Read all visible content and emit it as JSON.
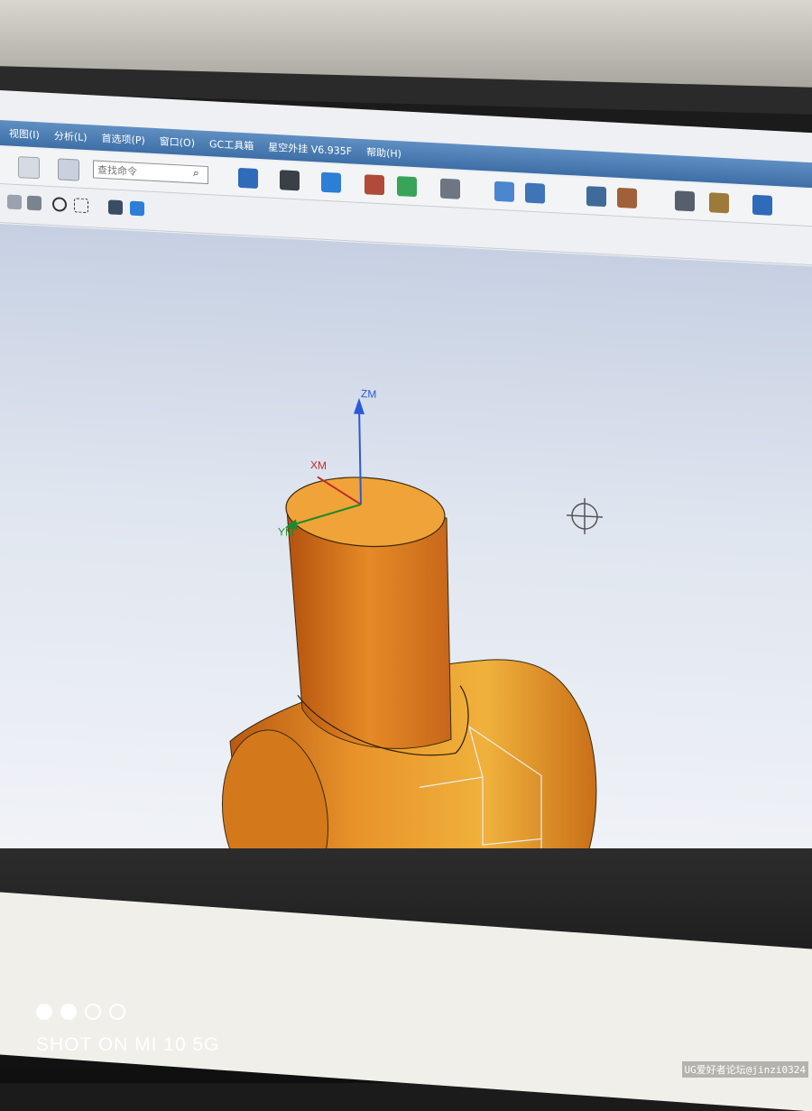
{
  "menu": {
    "items": [
      {
        "label": "视图(I)"
      },
      {
        "label": "分析(L)"
      },
      {
        "label": "首选项(P)"
      },
      {
        "label": "窗口(O)"
      },
      {
        "label": "GC工具箱"
      },
      {
        "label": "星空外挂 V6.935F"
      },
      {
        "label": "帮助(H)"
      }
    ]
  },
  "toolbar": {
    "search_placeholder": "查找命令"
  },
  "axes": {
    "z_label": "ZM",
    "x_label": "XM",
    "y_label": "YM"
  },
  "camera_watermark": {
    "shot_text": "SHOT ON MI 10 5G"
  },
  "forum_watermark": "UG爱好者论坛@jinzi0324",
  "colors": {
    "part_orange": "#e8942a",
    "menubar_blue": "#4b7cb4",
    "axis_z": "#2a5ad6",
    "axis_x": "#c0282c",
    "axis_y": "#1e8a2e"
  }
}
